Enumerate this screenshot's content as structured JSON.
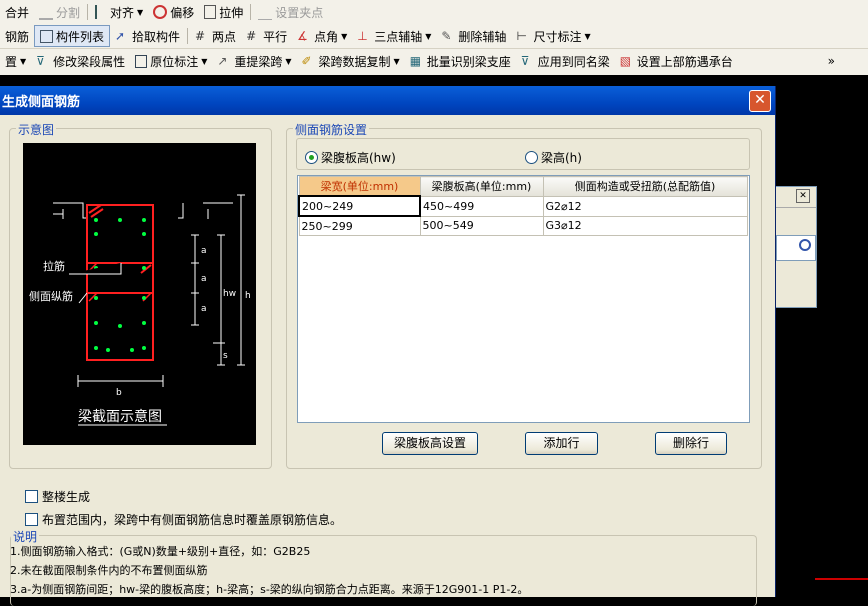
{
  "toolbar": {
    "row1": {
      "merge": "合并",
      "split": "分割",
      "align": "对齐",
      "offset": "偏移",
      "stretch": "拉伸",
      "set_grip": "设置夹点"
    },
    "row2": {
      "rebar": "钢筋",
      "component_list": "构件列表",
      "pick_component": "拾取构件",
      "two_points": "两点",
      "parallel": "平行",
      "point_angle": "点角",
      "three_point_aux": "三点辅轴",
      "delete_aux": "删除辅轴",
      "dimension": "尺寸标注"
    },
    "row3": {
      "settings": "置",
      "modify_beam_props": "修改梁段属性",
      "origin_label": "原位标注",
      "re_extract_span": "重提梁跨",
      "copy_span_data": "梁跨数据复制",
      "batch_identify_support": "批量识别梁支座",
      "apply_same_name_beam": "应用到同名梁",
      "set_top_rebar_cap": "设置上部筋遇承台",
      "overflow": "»"
    }
  },
  "dialog": {
    "title": "生成侧面钢筋",
    "close": "✕",
    "schematic_legend": "示意图",
    "schematic": {
      "tie_label": "拉筋",
      "side_long_label": "侧面纵筋",
      "caption": "梁截面示意图",
      "a1": "a",
      "a2": "a",
      "a3": "a",
      "hw": "hw",
      "h": "h",
      "s": "s",
      "b": "b"
    },
    "settings_legend": "侧面钢筋设置",
    "radio_hw": "梁腹板高(hw)",
    "radio_h": "梁高(h)",
    "table": {
      "headers": [
        "梁宽(单位:mm)",
        "梁腹板高(单位:mm)",
        "侧面构造或受扭筋(总配筋值)"
      ],
      "rows": [
        [
          "200~249",
          "450~499",
          "G2⌀12"
        ],
        [
          "250~299",
          "500~549",
          "G3⌀12"
        ]
      ]
    },
    "buttons": {
      "web_height_settings": "梁腹板高设置",
      "add_row": "添加行",
      "delete_row": "删除行"
    },
    "check_whole_floor": "整楼生成",
    "check_overwrite": "布置范围内，梁跨中有侧面钢筋信息时覆盖原钢筋信息。",
    "notes_legend": "说明",
    "notes": [
      "1.侧面钢筋输入格式：(G或N)数量+级别+直径，如：G2B25",
      "2.未在截面限制条件内的不布置侧面纵筋",
      "3.a-为侧面钢筋间距；hw-梁的腹板高度；h-梁高；s-梁的纵向钢筋合力点距离。来源于12G901-1 P1-2。"
    ]
  },
  "background_window": {
    "close": "✕"
  },
  "colors": {
    "title_bar": "#0046c0",
    "legend_text": "#1c48b6",
    "rebar_red": "#ff2020",
    "rebar_green": "#00ff40"
  }
}
